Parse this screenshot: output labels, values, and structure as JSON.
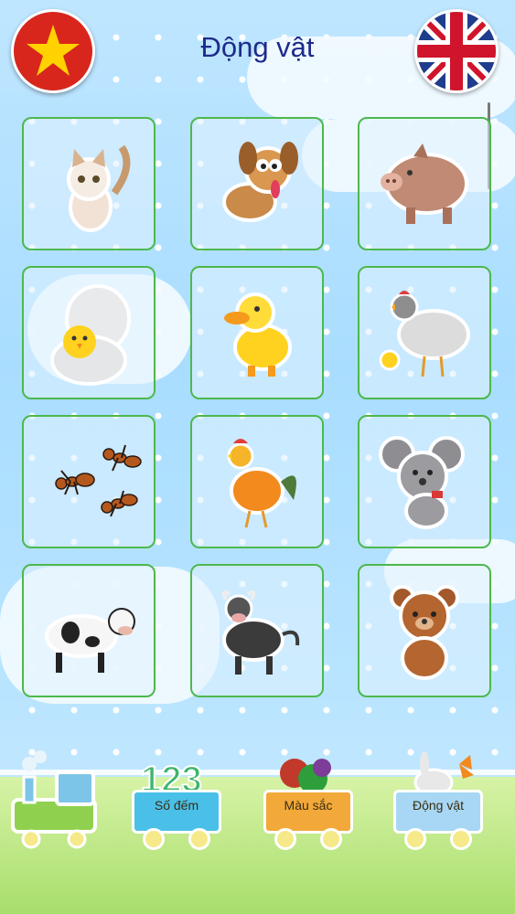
{
  "header": {
    "title": "Động vật"
  },
  "flags": [
    {
      "name": "vietnam-flag",
      "colors": {
        "field": "#d8261c",
        "star": "#ffd200"
      }
    },
    {
      "name": "uk-flag",
      "colors": {
        "blue": "#1f3d8c",
        "red": "#cf142b",
        "white": "#ffffff"
      }
    }
  ],
  "animals": [
    {
      "name": "cat",
      "icon": "cat-icon"
    },
    {
      "name": "dog",
      "icon": "dog-icon"
    },
    {
      "name": "pig",
      "icon": "pig-icon"
    },
    {
      "name": "chick",
      "icon": "chick-hatching-icon"
    },
    {
      "name": "duck",
      "icon": "duck-icon"
    },
    {
      "name": "hen",
      "icon": "hen-icon"
    },
    {
      "name": "ant",
      "icon": "ants-icon"
    },
    {
      "name": "rooster",
      "icon": "rooster-icon"
    },
    {
      "name": "mouse",
      "icon": "mouse-icon"
    },
    {
      "name": "cow",
      "icon": "cow-icon"
    },
    {
      "name": "bull",
      "icon": "bull-icon"
    },
    {
      "name": "bear",
      "icon": "bear-icon"
    }
  ],
  "train": {
    "cars": [
      {
        "label": "Số đếm",
        "color": "#4ac0e8"
      },
      {
        "label": "Màu sắc",
        "color": "#f2a93a"
      },
      {
        "label": "Động vật",
        "color": "#a7d7f4"
      }
    ]
  },
  "colors": {
    "card_border": "#4db84d",
    "title": "#1d2b8c"
  }
}
